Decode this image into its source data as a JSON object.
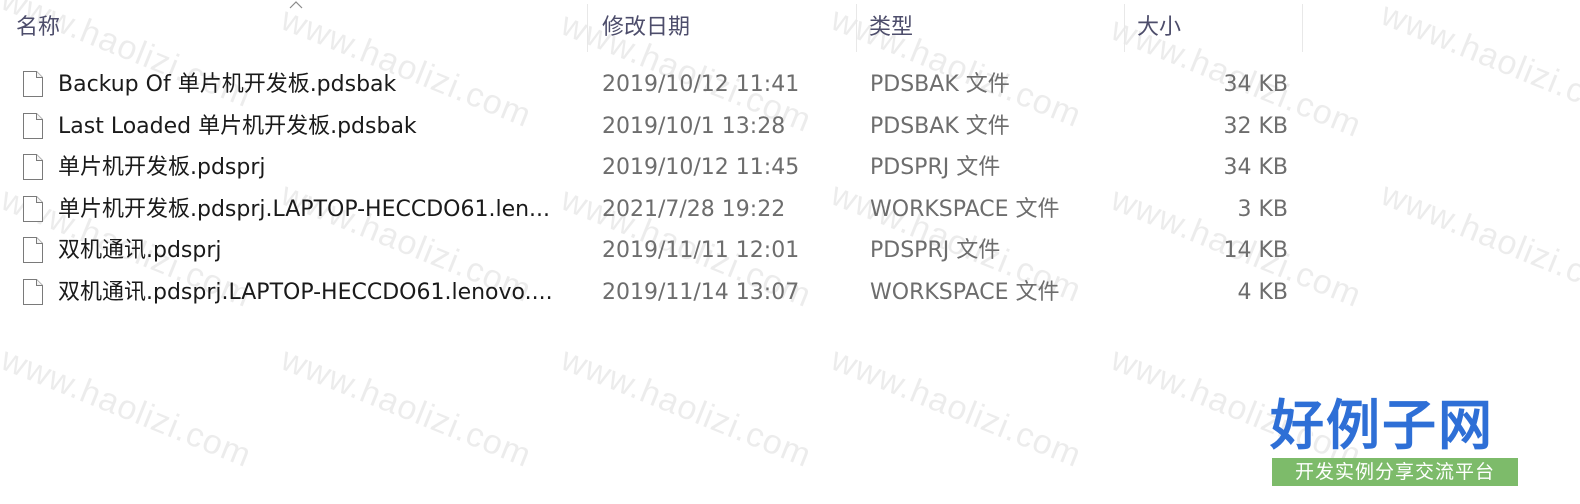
{
  "columns": {
    "name": "名称",
    "date_modified": "修改日期",
    "type": "类型",
    "size": "大小"
  },
  "files": [
    {
      "name": "Backup Of 单片机开发板.pdsbak",
      "date": "2019/10/12 11:41",
      "type": "PDSBAK 文件",
      "size": "34 KB"
    },
    {
      "name": "Last Loaded 单片机开发板.pdsbak",
      "date": "2019/10/1 13:28",
      "type": "PDSBAK 文件",
      "size": "32 KB"
    },
    {
      "name": "单片机开发板.pdsprj",
      "date": "2019/10/12 11:45",
      "type": "PDSPRJ 文件",
      "size": "34 KB"
    },
    {
      "name": "单片机开发板.pdsprj.LAPTOP-HECCDO61.len...",
      "date": "2021/7/28 19:22",
      "type": "WORKSPACE 文件",
      "size": "3 KB"
    },
    {
      "name": "双机通讯.pdsprj",
      "date": "2019/11/11 12:01",
      "type": "PDSPRJ 文件",
      "size": "14 KB"
    },
    {
      "name": "双机通讯.pdsprj.LAPTOP-HECCDO61.lenovo....",
      "date": "2019/11/14 13:07",
      "type": "WORKSPACE 文件",
      "size": "4 KB"
    }
  ],
  "icons": {
    "file": "file-icon",
    "sort": "sort-ascending-icon"
  },
  "watermark": {
    "text": "www.haolizi.com"
  },
  "logo": {
    "title": "好例子网",
    "subtitle": "开发实例分享交流平台"
  },
  "colors": {
    "header_text": "#4d4d6b",
    "name_text": "#1a1a1a",
    "detail_text": "#6d6d6d",
    "logo_blue": "#2e6fd6",
    "logo_green": "#7dbb6a"
  }
}
